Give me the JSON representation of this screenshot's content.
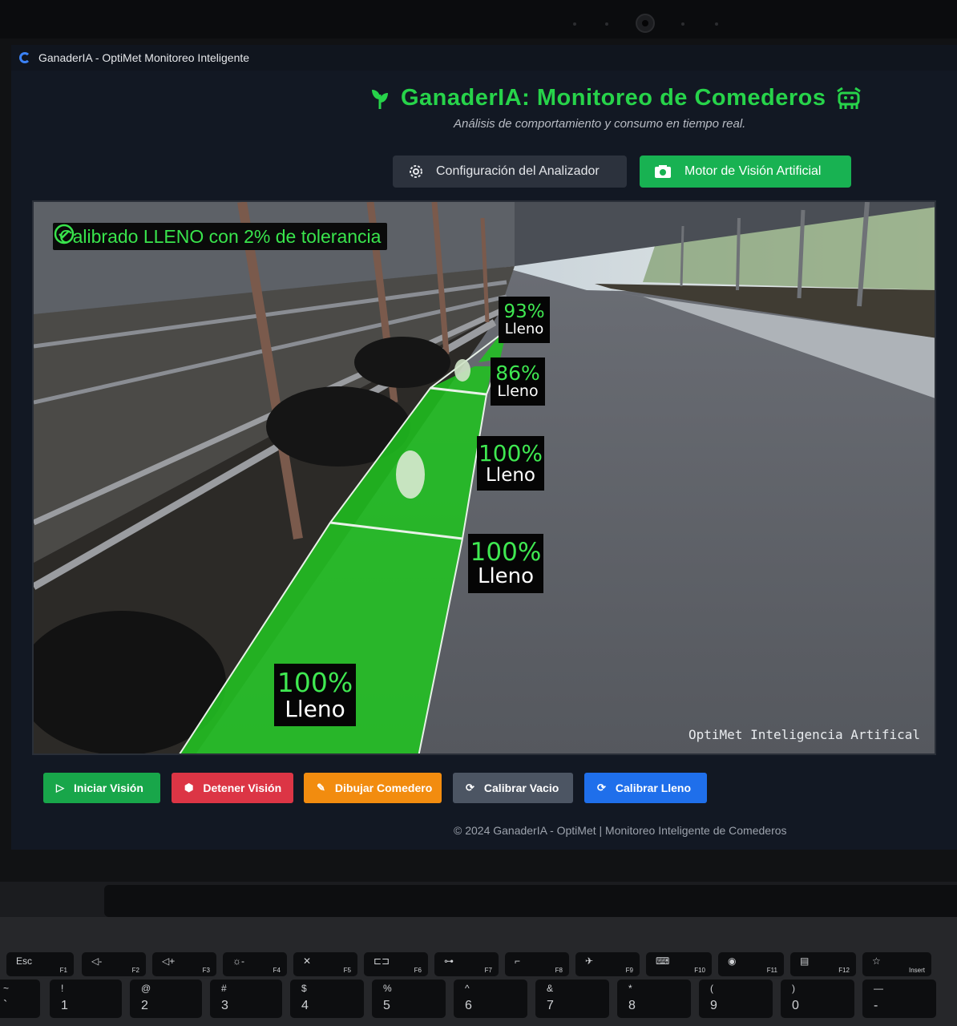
{
  "window": {
    "title": "GanaderIA - OptiMet Monitoreo Inteligente"
  },
  "header": {
    "title": "GanaderIA: Monitoreo de Comederos",
    "subtitle": "Análisis de comportamiento y consumo en tiempo real."
  },
  "tabs": {
    "config_label": "Configuración del Analizador",
    "vision_label": "Motor de Visión Artificial"
  },
  "feed": {
    "calibration_text": "Calibrado LLENO con 2% de tolerancia",
    "watermark": "OptiMet Inteligencia Artifical",
    "zones": [
      {
        "percent": "93%",
        "status": "Lleno"
      },
      {
        "percent": "86%",
        "status": "Lleno"
      },
      {
        "percent": "100%",
        "status": "Lleno"
      },
      {
        "percent": "100%",
        "status": "Lleno"
      },
      {
        "percent": "100%",
        "status": "Lleno"
      }
    ]
  },
  "controls": {
    "start": "Iniciar Visión",
    "stop": "Detener Visión",
    "draw": "Dibujar Comedero",
    "cal_empty": "Calibrar Vacio",
    "cal_full": "Calibrar Lleno"
  },
  "footer": {
    "text": "© 2024 GanaderIA - OptiMet | Monitoreo Inteligente de Comederos"
  },
  "colors": {
    "accent_green": "#27d34a",
    "start_btn": "#18a64a",
    "stop_btn": "#dc3545",
    "draw_btn": "#f28c0f",
    "cal_empty_btn": "#4c5563",
    "cal_full_btn": "#1f6feb"
  },
  "keyboard": {
    "fn_keys": [
      {
        "top": "Esc",
        "sub": "F1"
      },
      {
        "top": "◁-",
        "sub": "F2"
      },
      {
        "top": "◁+",
        "sub": "F3"
      },
      {
        "top": "☼-",
        "sub": "F4"
      },
      {
        "top": "✕",
        "sub": "F5"
      },
      {
        "top": "⊏⊐",
        "sub": "F6"
      },
      {
        "top": "⊶",
        "sub": "F7"
      },
      {
        "top": "⌐",
        "sub": "F8"
      },
      {
        "top": "✈",
        "sub": "F9"
      },
      {
        "top": "⌨",
        "sub": "F10"
      },
      {
        "top": "◉",
        "sub": "F11"
      },
      {
        "top": "▤",
        "sub": "F12"
      },
      {
        "top": "☆",
        "sub": "Insert"
      }
    ],
    "num_keys": [
      {
        "up": "~",
        "down": "`"
      },
      {
        "up": "!",
        "down": "1"
      },
      {
        "up": "@",
        "down": "2"
      },
      {
        "up": "#",
        "down": "3"
      },
      {
        "up": "$",
        "down": "4"
      },
      {
        "up": "%",
        "down": "5"
      },
      {
        "up": "^",
        "down": "6"
      },
      {
        "up": "&",
        "down": "7"
      },
      {
        "up": "*",
        "down": "8"
      },
      {
        "up": "(",
        "down": "9"
      },
      {
        "up": ")",
        "down": "0"
      },
      {
        "up": "—",
        "down": "-"
      }
    ]
  }
}
